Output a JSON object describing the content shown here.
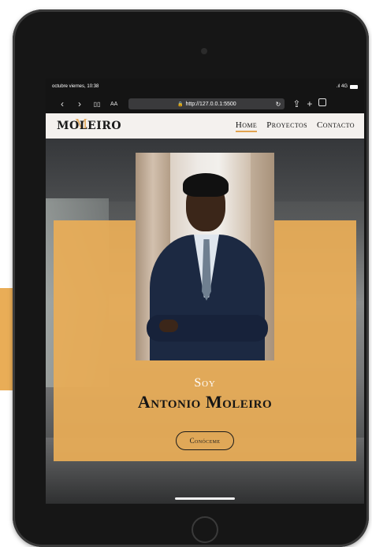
{
  "status_bar": {
    "time": "octubre viernes, 10:38",
    "signal": ".ıl 4G"
  },
  "browser": {
    "back_icon": "chevron-left-icon",
    "forward_icon": "chevron-right-icon",
    "text_size": "AA",
    "url": "http://127.0.0.1:5500",
    "back_glyph": "‹",
    "forward_glyph": "›",
    "bookmarks_glyph": "▯▯",
    "lock_glyph": "🔒",
    "reload_glyph": "↻",
    "share_glyph": "⇪",
    "add_glyph": "+"
  },
  "site": {
    "logo": "MOLEIRO",
    "logo_mark": "M",
    "nav": [
      {
        "label": "Home",
        "active": true
      },
      {
        "label": "Proyectos",
        "active": false
      },
      {
        "label": "Contacto",
        "active": false
      }
    ],
    "accent_color": "#e9ad57"
  },
  "hero": {
    "subtitle": "Soy",
    "title": "Antonio Moleiro",
    "cta_label": "Conóceme"
  }
}
